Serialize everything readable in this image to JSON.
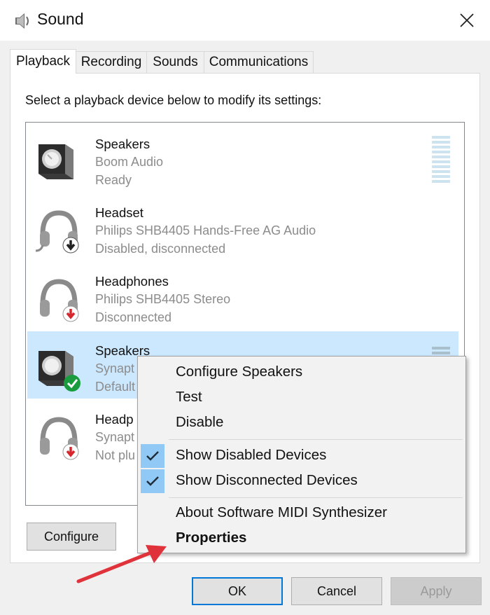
{
  "window": {
    "title": "Sound",
    "icon": "speaker-icon",
    "close_icon": "close-icon"
  },
  "tabs": [
    {
      "label": "Playback",
      "active": true
    },
    {
      "label": "Recording",
      "active": false
    },
    {
      "label": "Sounds",
      "active": false
    },
    {
      "label": "Communications",
      "active": false
    }
  ],
  "instruction": "Select a playback device below to modify its settings:",
  "devices": [
    {
      "name": "Speakers",
      "sub": "Boom Audio",
      "status": "Ready",
      "icon": "speaker-icon",
      "badge": "",
      "meter": true
    },
    {
      "name": "Headset",
      "sub": "Philips SHB4405 Hands-Free AG Audio",
      "status": "Disabled, disconnected",
      "icon": "headset-icon",
      "badge": "down-arrow-black-icon",
      "meter": false
    },
    {
      "name": "Headphones",
      "sub": "Philips SHB4405 Stereo",
      "status": "Disconnected",
      "icon": "headphones-icon",
      "badge": "down-arrow-red-icon",
      "meter": false
    },
    {
      "name": "Speakers",
      "sub": "Synapt",
      "status": "Default",
      "icon": "speaker-icon",
      "badge": "green-check-icon",
      "meter": true,
      "selected": true
    },
    {
      "name": "Headp",
      "sub": "Synapt",
      "status": "Not plu",
      "icon": "headphones-icon",
      "badge": "down-arrow-red-icon",
      "meter": false
    }
  ],
  "context_menu": {
    "items": [
      {
        "label": "Configure Speakers",
        "checked": false,
        "bold": false
      },
      {
        "label": "Test",
        "checked": false,
        "bold": false
      },
      {
        "label": "Disable",
        "checked": false,
        "bold": false
      },
      {
        "label": "Show Disabled Devices",
        "checked": true,
        "bold": false
      },
      {
        "label": "Show Disconnected Devices",
        "checked": true,
        "bold": false
      },
      {
        "label": "About Software MIDI Synthesizer",
        "checked": false,
        "bold": false
      },
      {
        "label": "Properties",
        "checked": false,
        "bold": true
      }
    ]
  },
  "buttons": {
    "configure": "Configure",
    "ok": "OK",
    "cancel": "Cancel",
    "apply": "Apply"
  },
  "colors": {
    "selection": "#cce8ff",
    "accent": "#0078d7",
    "annotation_arrow": "#e0323a",
    "check_highlight": "#90c8f6"
  }
}
